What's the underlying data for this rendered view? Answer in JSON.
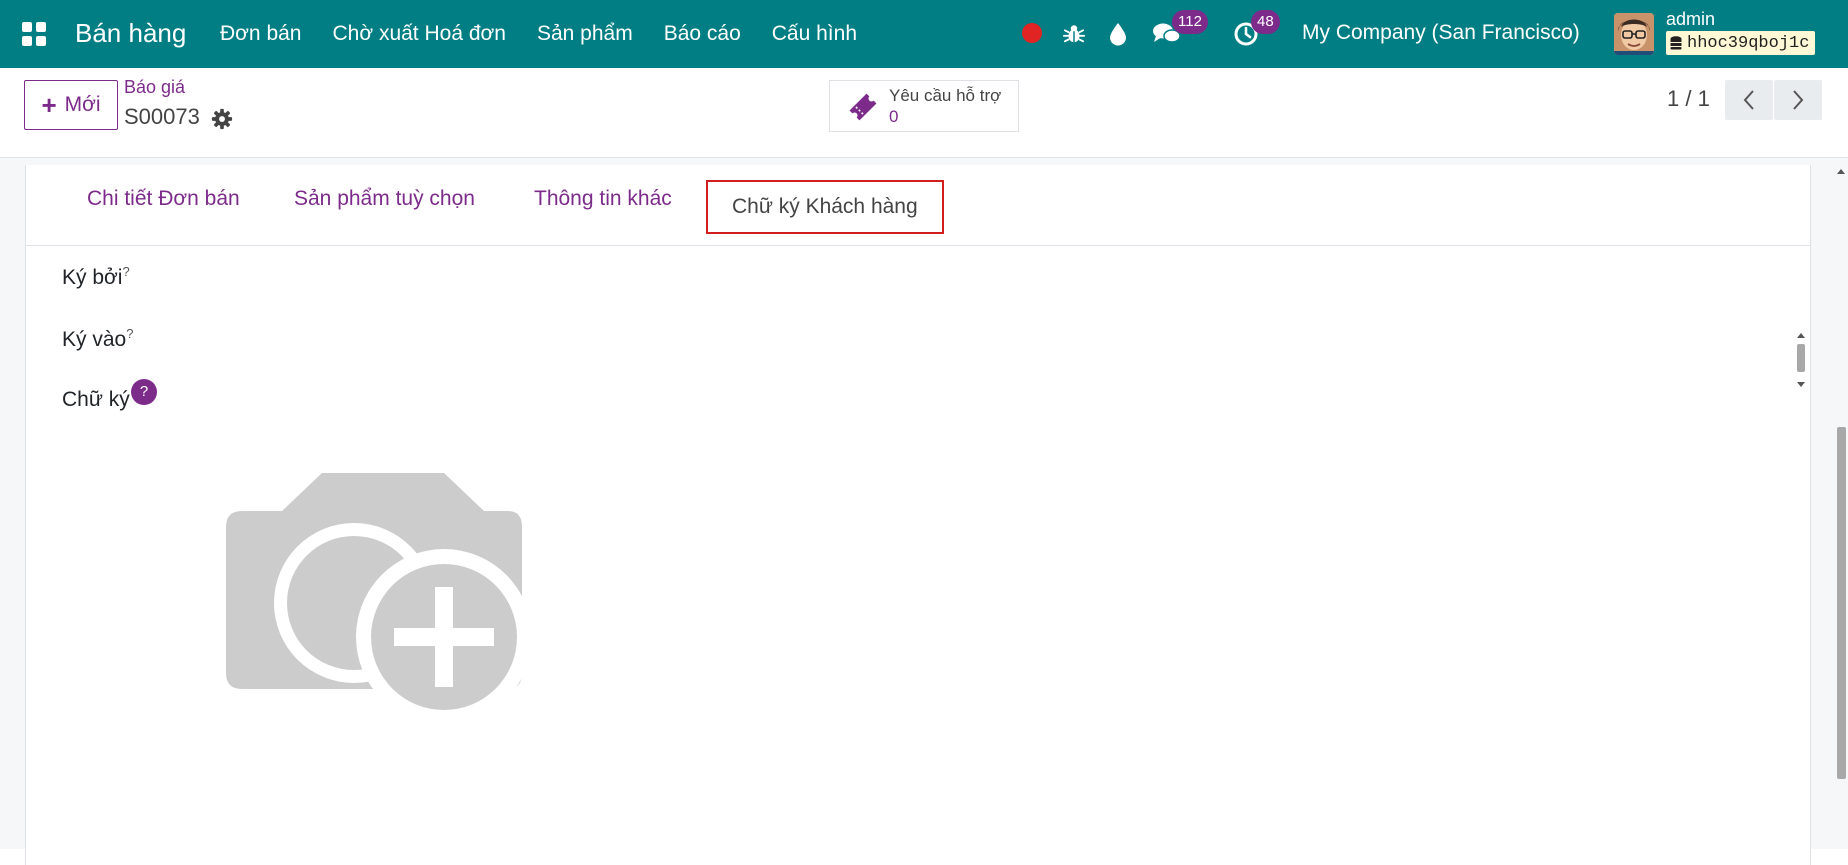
{
  "navbar": {
    "brand": "Bán hàng",
    "menu": [
      "Đơn bán",
      "Chờ xuất Hoá đơn",
      "Sản phẩm",
      "Báo cáo",
      "Cấu hình"
    ],
    "messages_badge": "112",
    "activities_badge": "48",
    "company": "My Company (San Francisco)",
    "user": "admin",
    "database": "hhoc39qboj1c"
  },
  "control": {
    "new_button": "Mới",
    "breadcrumb_parent": "Báo giá",
    "breadcrumb_current": "S00073",
    "smart_button": {
      "label": "Yêu cầu hỗ trợ",
      "value": "0"
    },
    "pager": "1 / 1"
  },
  "tabs": [
    "Chi tiết Đơn bán",
    "Sản phẩm tuỳ chọn",
    "Thông tin khác",
    "Chữ ký Khách hàng"
  ],
  "fields": {
    "signed_by": "Ký bởi",
    "signed_on": "Ký vào",
    "signature": "Chữ ký",
    "help_mark": "?"
  },
  "colors": {
    "navbar": "#017e84",
    "primary": "#7c2b8b",
    "record": "#e02424",
    "highlight": "#d31e1e"
  }
}
